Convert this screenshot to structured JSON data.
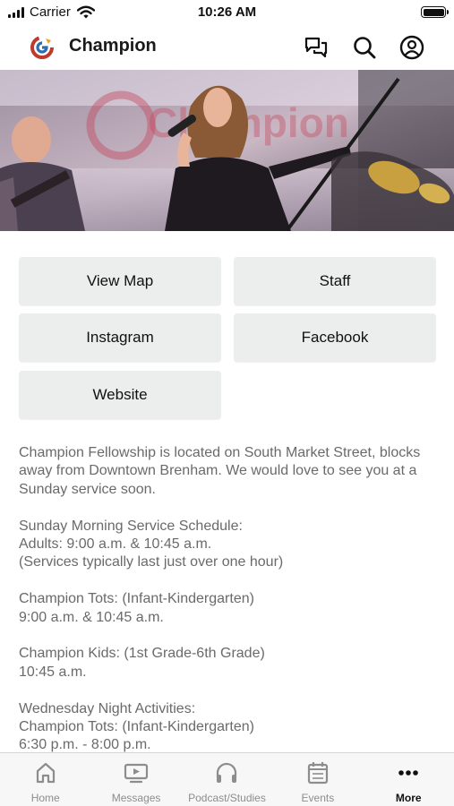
{
  "status_bar": {
    "carrier": "Carrier",
    "time": "10:26 AM"
  },
  "header": {
    "title": "Champion"
  },
  "hero": {
    "watermark_text": "Champion"
  },
  "buttons": {
    "view_map": "View Map",
    "staff": "Staff",
    "instagram": "Instagram",
    "facebook": "Facebook",
    "website": "Website"
  },
  "description": {
    "paragraphs": [
      [
        "Champion Fellowship is located on South Market Street, blocks away from Downtown Brenham. We would love to see you at a Sunday service soon."
      ],
      [
        "Sunday Morning Service Schedule:",
        "Adults: 9:00 a.m. & 10:45 a.m.",
        "(Services typically last just over one hour)"
      ],
      [
        "Champion Tots: (Infant-Kindergarten)",
        "9:00 a.m. & 10:45 a.m."
      ],
      [
        "Champion Kids: (1st Grade-6th Grade)",
        "10:45 a.m."
      ],
      [
        "Wednesday Night Activities:",
        "Champion Tots: (Infant-Kindergarten)",
        "6:30 p.m. - 8:00 p.m."
      ]
    ]
  },
  "tabs": [
    {
      "label": "Home",
      "icon": "home-icon"
    },
    {
      "label": "Messages",
      "icon": "video-icon"
    },
    {
      "label": "Podcast/Studies",
      "icon": "headphones-icon"
    },
    {
      "label": "Events",
      "icon": "calendar-icon"
    },
    {
      "label": "More",
      "icon": "more-icon",
      "active": true
    }
  ],
  "colors": {
    "accent": "#111111",
    "button_bg": "#eceded",
    "tab_inactive": "#8d8d8d",
    "body_text": "#6a6a6a"
  }
}
